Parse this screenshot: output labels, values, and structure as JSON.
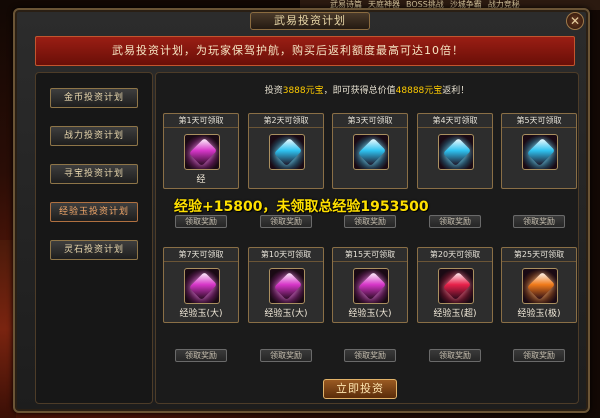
{
  "topbar": {
    "items": [
      "武易诗篇",
      "天庭神器",
      "BOSS挑战",
      "沙城争霸",
      "战力竞秘"
    ]
  },
  "window": {
    "title": "武易投资计划",
    "close": "✕"
  },
  "banner": {
    "text": "武易投资计划，为玩家保驾护航，购买后返利额度最高可达10倍！"
  },
  "sidebar": {
    "items": [
      {
        "label": "金币投资计划",
        "active": false
      },
      {
        "label": "战力投资计划",
        "active": false
      },
      {
        "label": "寻宝投资计划",
        "active": false
      },
      {
        "label": "经验玉投资计划",
        "active": true
      },
      {
        "label": "灵石投资计划",
        "active": false
      }
    ]
  },
  "invest": {
    "prefix": "投资",
    "amount": "3888元宝",
    "mid": "，即可获得总价值",
    "value": "48888元宝",
    "suffix": "返利！"
  },
  "row1": [
    {
      "header": "第1天可领取",
      "gem_color": "#d636c8",
      "caption": "经"
    },
    {
      "header": "第2天可领取",
      "gem_color": "#2ec2f0",
      "caption": ""
    },
    {
      "header": "第3天可领取",
      "gem_color": "#2ec2f0",
      "caption": ""
    },
    {
      "header": "第4天可领取",
      "gem_color": "#2ec2f0",
      "caption": ""
    },
    {
      "header": "第5天可领取",
      "gem_color": "#2ec2f0",
      "caption": ""
    }
  ],
  "row2": [
    {
      "header": "第7天可领取",
      "gem_color": "#d636c8",
      "caption": "经验玉(大)"
    },
    {
      "header": "第10天可领取",
      "gem_color": "#d636c8",
      "caption": "经验玉(大)"
    },
    {
      "header": "第15天可领取",
      "gem_color": "#d636c8",
      "caption": "经验玉(大)"
    },
    {
      "header": "第20天可领取",
      "gem_color": "#e8224a",
      "caption": "经验玉(超)"
    },
    {
      "header": "第25天可领取",
      "gem_color": "#f07a1a",
      "caption": "经验玉(极)"
    }
  ],
  "claim_label": "领取奖励",
  "overlay_text": "经验+15800，未领取总经验1953500",
  "invest_button": "立即投资"
}
